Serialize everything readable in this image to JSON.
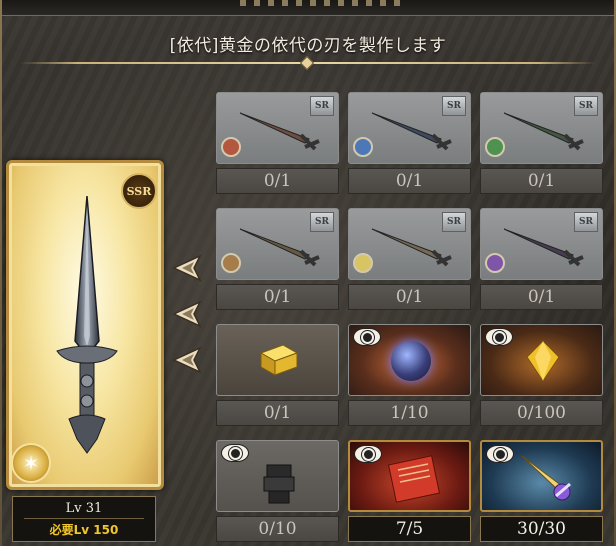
{
  "title": "[依代]黄金の依代の刃を製作します",
  "main_item": {
    "rarity": "SSR",
    "element_icon": "light-element-icon",
    "level": "Lv 31",
    "required_level": "必要Lv 150"
  },
  "materials": [
    {
      "name": "fire-sr-dagger",
      "type": "weapon",
      "badge": "SR",
      "orb_color": "#d2502c",
      "count": "0/1",
      "met": false
    },
    {
      "name": "water-sr-dagger",
      "type": "weapon",
      "badge": "SR",
      "orb_color": "#3c7ad6",
      "count": "0/1",
      "met": false
    },
    {
      "name": "wind-sr-dagger",
      "type": "weapon",
      "badge": "SR",
      "orb_color": "#3a9a3a",
      "count": "0/1",
      "met": false
    },
    {
      "name": "earth-sr-dagger",
      "type": "weapon",
      "badge": "SR",
      "orb_color": "#b57a32",
      "count": "0/1",
      "met": false
    },
    {
      "name": "light-sr-dagger",
      "type": "weapon",
      "badge": "SR",
      "orb_color": "#e2c53a",
      "count": "0/1",
      "met": false
    },
    {
      "name": "dark-sr-dagger",
      "type": "weapon",
      "badge": "SR",
      "orb_color": "#8a4fc4",
      "count": "0/1",
      "met": false
    },
    {
      "name": "gold-bar",
      "type": "item",
      "count": "0/1",
      "met": false,
      "eye": false
    },
    {
      "name": "dark-orb",
      "type": "item",
      "count": "1/10",
      "met": false,
      "eye": true
    },
    {
      "name": "gold-gem",
      "type": "item",
      "count": "0/100",
      "met": false,
      "eye": true
    },
    {
      "name": "dark-armor-piece",
      "type": "item",
      "count": "0/10",
      "met": false,
      "eye": true
    },
    {
      "name": "red-scroll",
      "type": "item",
      "count": "7/5",
      "met": true,
      "eye": true
    },
    {
      "name": "crystal-dagger",
      "type": "item",
      "count": "30/30",
      "met": true,
      "eye": true
    }
  ]
}
